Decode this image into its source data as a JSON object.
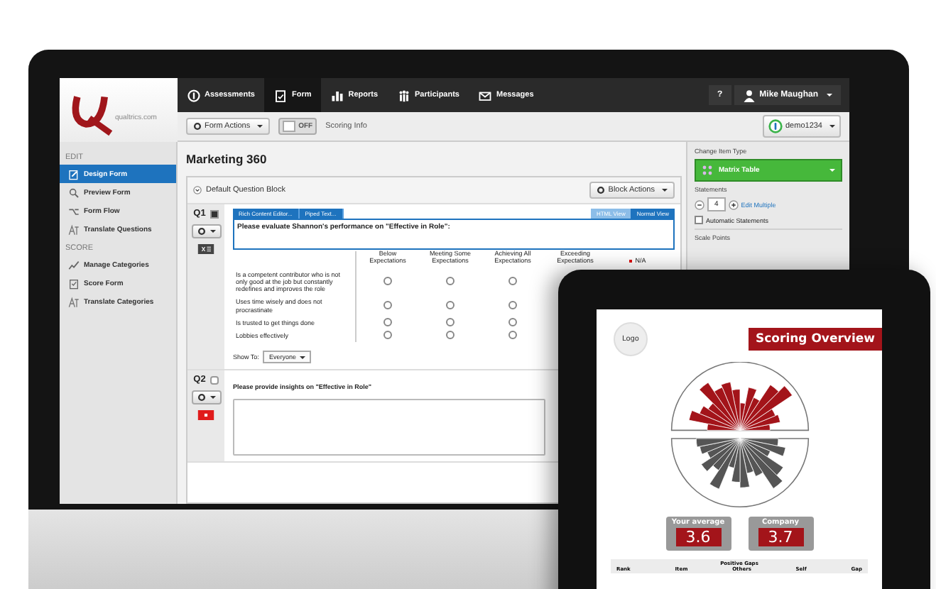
{
  "monitor": {
    "logo": {
      "text": "qualtrics.com"
    },
    "nav": [
      {
        "label": "Assessments",
        "selected": false
      },
      {
        "label": "Form",
        "selected": true
      },
      {
        "label": "Reports",
        "selected": false
      },
      {
        "label": "Participants",
        "selected": false
      },
      {
        "label": "Messages",
        "selected": false
      }
    ],
    "help": "?",
    "user": "Mike Maughan",
    "toolbar": {
      "form_actions": "Form Actions",
      "toggle": {
        "label": "OFF",
        "on": false
      },
      "scoring_info": "Scoring Info",
      "account": "demo1234"
    },
    "sidebar": [
      {
        "heading": "EDIT",
        "items": [
          {
            "label": "Design Form",
            "selected": true
          },
          {
            "label": "Preview Form",
            "selected": false
          },
          {
            "label": "Form Flow",
            "selected": false
          },
          {
            "label": "Translate Questions",
            "selected": false
          }
        ]
      },
      {
        "heading": "SCORE",
        "items": [
          {
            "label": "Manage Categories",
            "selected": false
          },
          {
            "label": "Score Form",
            "selected": false
          },
          {
            "label": "Translate Categories",
            "selected": false
          }
        ]
      }
    ],
    "title": "Marketing 360",
    "block": {
      "name": "Default Question Block",
      "actions": "Block Actions"
    },
    "questions": [
      {
        "kind": "matrix",
        "number": "Q1",
        "checked": true,
        "editor_tabs": [
          "Rich Content Editor...",
          "Piped Text..."
        ],
        "view_tabs": [
          {
            "label": "HTML View",
            "selected": false
          },
          {
            "label": "Normal View",
            "selected": true
          }
        ],
        "text": "Please evaluate Shannon's performance on \"Effective in Role\":",
        "columns": [
          "Below Expectations",
          "Meeting Some Expectations",
          "Achieving All Expectations",
          "Exceeding Expectations",
          "N/A"
        ],
        "rows": [
          {
            "label": "Is a competent contributor who is not only good at the job but constantly redefines and improves the role",
            "options": [
              {
                "selected": false
              },
              {
                "selected": false
              },
              {
                "selected": false
              }
            ]
          },
          {
            "label": "Uses time wisely and does not procrastinate",
            "options": [
              {
                "selected": false
              },
              {
                "selected": false
              },
              {
                "selected": false
              }
            ]
          },
          {
            "label": "Is trusted to get things done",
            "options": [
              {
                "selected": false
              },
              {
                "selected": false
              },
              {
                "selected": false
              }
            ]
          },
          {
            "label": "Lobbies effectively",
            "options": [
              {
                "selected": false
              },
              {
                "selected": false
              },
              {
                "selected": false
              }
            ]
          }
        ],
        "show_to": {
          "label": "Show To:",
          "value": "Everyone"
        }
      },
      {
        "kind": "text_entry",
        "number": "Q2",
        "checked": false,
        "text": "Please provide insights on \"Effective in Role\""
      }
    ],
    "item_panel": {
      "heading": "Change Item Type",
      "type": "Matrix Table",
      "statements_label": "Statements",
      "statements": "4",
      "edit_multiple": "Edit Multiple",
      "automatic": {
        "label": "Automatic Statements",
        "checked": false
      },
      "scale_points": "Scale Points"
    }
  },
  "tablet": {
    "logo": "Logo",
    "title": "Scoring Overview",
    "cards": [
      {
        "label": "Your average",
        "value": "3.6"
      },
      {
        "label": "Company",
        "value": "3.7"
      }
    ],
    "table": {
      "title": "Positive Gaps",
      "columns": [
        "Rank",
        "Item",
        "Others",
        "Self",
        "Gap"
      ]
    }
  }
}
